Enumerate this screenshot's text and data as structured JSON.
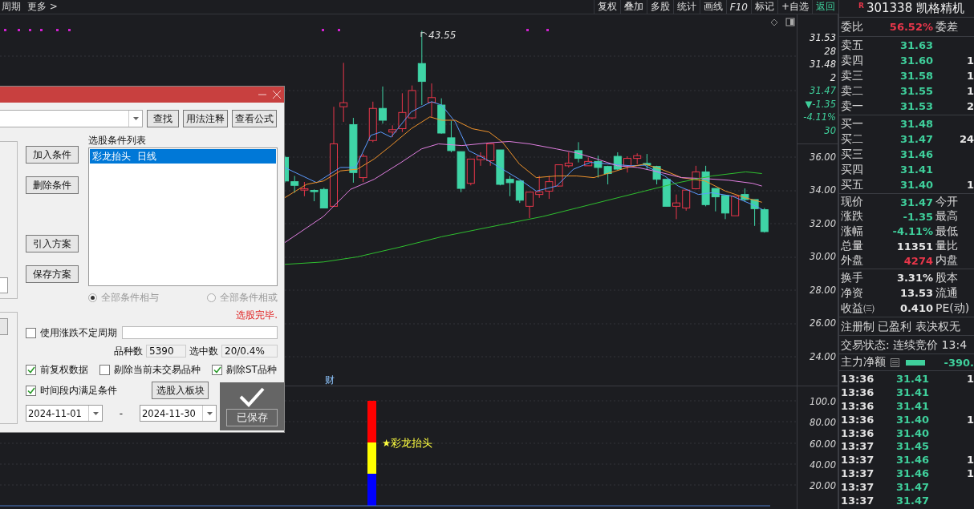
{
  "toolbar": {
    "left": [
      "周期",
      "更多 >"
    ],
    "buttons": [
      {
        "label": "复权",
        "kind": "tool"
      },
      {
        "label": "叠加",
        "kind": "tool"
      },
      {
        "label": "多股",
        "kind": "tool"
      },
      {
        "label": "统计",
        "kind": "tool"
      },
      {
        "label": "画线",
        "kind": "tool"
      },
      {
        "label": "F10",
        "kind": "italic"
      },
      {
        "label": "标记",
        "kind": "tool"
      },
      {
        "label": "+自选",
        "kind": "tool"
      },
      {
        "label": "返回",
        "kind": "back"
      }
    ]
  },
  "chart": {
    "high_label": "43.55",
    "marker": "财",
    "axis_quote": [
      {
        "text": "31.53",
        "color": "#e8e8e8"
      },
      {
        "text": "28",
        "color": "#e8e8e8"
      },
      {
        "text": "31.48",
        "color": "#e8e8e8"
      },
      {
        "text": "2",
        "color": "#e8e8e8"
      },
      {
        "text": "31.47",
        "color": "#3fcf9b"
      },
      {
        "text": "▼-1.35",
        "color": "#3fcf9b"
      },
      {
        "text": "-4.11%",
        "color": "#3fcf9b"
      },
      {
        "text": "30",
        "color": "#3fcf9b"
      }
    ],
    "price_ticks": [
      "36.00",
      "34.00",
      "32.00",
      "30.00",
      "28.00",
      "26.00",
      "24.00"
    ],
    "indicator": {
      "label": "★彩龙抬头",
      "ticks": [
        "100.0",
        "80.00",
        "60.00",
        "40.00",
        "20.00"
      ]
    }
  },
  "quote": {
    "badge": "R",
    "code": "301338",
    "name": "凯格精机",
    "ratio": {
      "label": "委比",
      "value": "56.52%",
      "tail": "委差"
    },
    "asks": [
      {
        "label": "卖五",
        "price": "31.63"
      },
      {
        "label": "卖四",
        "price": "31.60",
        "volume": "1"
      },
      {
        "label": "卖三",
        "price": "31.58",
        "volume": "1"
      },
      {
        "label": "卖二",
        "price": "31.55",
        "volume": "1"
      },
      {
        "label": "卖一",
        "price": "31.53",
        "volume": "2"
      }
    ],
    "bids": [
      {
        "label": "买一",
        "price": "31.48"
      },
      {
        "label": "买二",
        "price": "31.47",
        "volume": "24"
      },
      {
        "label": "买三",
        "price": "31.46"
      },
      {
        "label": "买四",
        "price": "31.41"
      },
      {
        "label": "买五",
        "price": "31.40",
        "volume": "1"
      }
    ],
    "stats": [
      {
        "label": "现价",
        "value": "31.47",
        "tail": "今开",
        "color": "#3fcf9b"
      },
      {
        "label": "涨跌",
        "value": "-1.35",
        "tail": "最高",
        "color": "#3fcf9b"
      },
      {
        "label": "涨幅",
        "value": "-4.11%",
        "tail": "最低",
        "color": "#3fcf9b"
      },
      {
        "label": "总量",
        "value": "11351",
        "tail": "量比",
        "color": "#e8e8e8"
      },
      {
        "label": "外盘",
        "value": "4274",
        "tail": "内盘",
        "color": "#e8364a"
      }
    ],
    "fundamentals": [
      {
        "label": "换手",
        "value": "3.31%",
        "tail": "股本"
      },
      {
        "label": "净资",
        "value": "13.53",
        "tail": "流通"
      },
      {
        "label": "收益㈢",
        "value": "0.410",
        "tail": "PE(动)"
      }
    ],
    "tags": "注册制 已盈利 表决权无",
    "trade_status": "交易状态: 连续竞价 13:4",
    "main_flow": {
      "label": "主力净额",
      "value": "-390."
    },
    "ticks": [
      {
        "time": "13:36",
        "price": "31.41",
        "volume": "1"
      },
      {
        "time": "13:36",
        "price": "31.41"
      },
      {
        "time": "13:36",
        "price": "31.41"
      },
      {
        "time": "13:36",
        "price": "31.40",
        "volume": "1"
      },
      {
        "time": "13:36",
        "price": "31.40"
      },
      {
        "time": "13:37",
        "price": "31.45"
      },
      {
        "time": "13:37",
        "price": "31.46",
        "volume": "1"
      },
      {
        "time": "13:37",
        "price": "31.46",
        "volume": "1"
      },
      {
        "time": "13:37",
        "price": "31.47"
      },
      {
        "time": "13:37",
        "price": "31.47"
      }
    ]
  },
  "dialog": {
    "search_buttons": [
      "查找",
      "用法注释",
      "查看公式"
    ],
    "side_buttons": [
      "加入条件",
      "删除条件",
      "引入方案",
      "保存方案"
    ],
    "list_title": "选股条件列表",
    "conditions": [
      {
        "text": "彩龙抬头  日线",
        "selected": true
      }
    ],
    "logic": [
      {
        "label": "全部条件相与",
        "selected": true,
        "disabled": true
      },
      {
        "label": "全部条件相或",
        "selected": false,
        "disabled": true
      }
    ],
    "status": "选股完毕.",
    "period": {
      "label": "使用涨跌不定周期",
      "checked": false
    },
    "count_label": "品种数",
    "count": "5390",
    "hit_label": "选中数",
    "hits": "20/0.4%",
    "options": [
      {
        "label": "前复权数据",
        "checked": true
      },
      {
        "label": "剔除当前未交易品种",
        "checked": false
      },
      {
        "label": "剔除ST品种",
        "checked": true
      }
    ],
    "range": {
      "label": "时间段内满足条件",
      "checked": true
    },
    "to_block_button": "选股入板块",
    "start_date": "2024-11-01",
    "date_separator": "-",
    "end_date": "2024-11-30",
    "toast": "已保存"
  }
}
